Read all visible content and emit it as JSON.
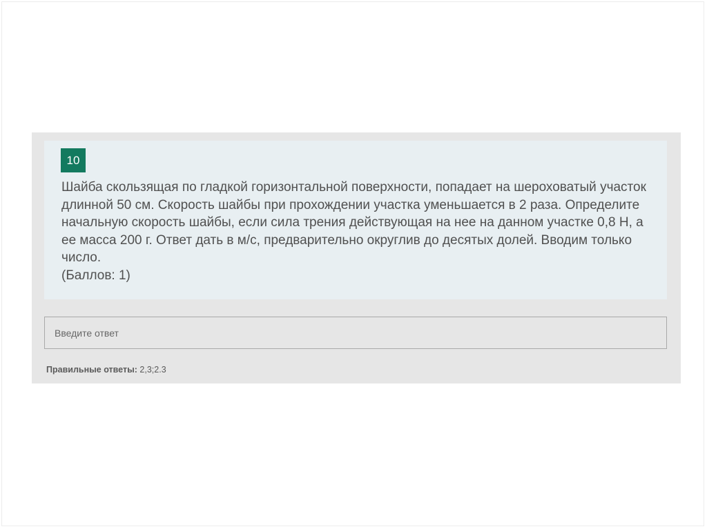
{
  "question": {
    "number": "10",
    "text": "Шайба скользящая по гладкой горизонтальной поверхности, попадает на шероховатый участок длинной 50 см. Скорость шайбы при прохождении участка уменьшается в 2 раза. Определите начальную скорость шайбы, если сила трения действующая на нее на данном участке 0,8 Н, а ее масса 200 г. Ответ дать в м/с, предварительно округлив до десятых долей. Вводим только число.",
    "points": "(Баллов: 1)",
    "number_badge_color": "#137a5f"
  },
  "answer": {
    "placeholder": "Введите ответ",
    "value": ""
  },
  "correct_answers": {
    "label": "Правильные ответы:",
    "value": "2,3;2.3"
  }
}
